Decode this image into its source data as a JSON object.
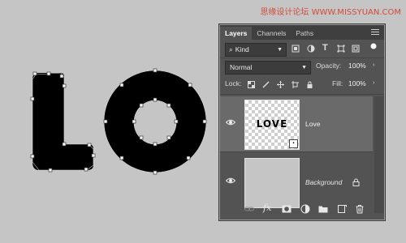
{
  "watermark": "思缘设计论坛  WWW.MISSYUAN.COM",
  "canvas": {
    "artwork_text": "LO",
    "background_color": "#c5c5c5",
    "text_color": "#000000"
  },
  "layers_panel": {
    "tabs": [
      {
        "label": "Layers",
        "active": true
      },
      {
        "label": "Channels",
        "active": false
      },
      {
        "label": "Paths",
        "active": false
      }
    ],
    "filter": {
      "label": "Kind"
    },
    "blend_mode": "Normal",
    "opacity": {
      "label": "Opacity:",
      "value": "100%"
    },
    "lock": {
      "label": "Lock:"
    },
    "fill": {
      "label": "Fill:",
      "value": "100%"
    },
    "layers": [
      {
        "name": "Love",
        "thumbnail_text": "LOVE",
        "selected": true,
        "visible": true
      },
      {
        "name": "Background",
        "selected": false,
        "visible": true,
        "locked": true
      }
    ],
    "footer_icons": [
      "link-icon",
      "fx-icon",
      "mask-icon",
      "adjustment-icon",
      "folder-icon",
      "new-layer-icon",
      "trash-icon"
    ]
  }
}
